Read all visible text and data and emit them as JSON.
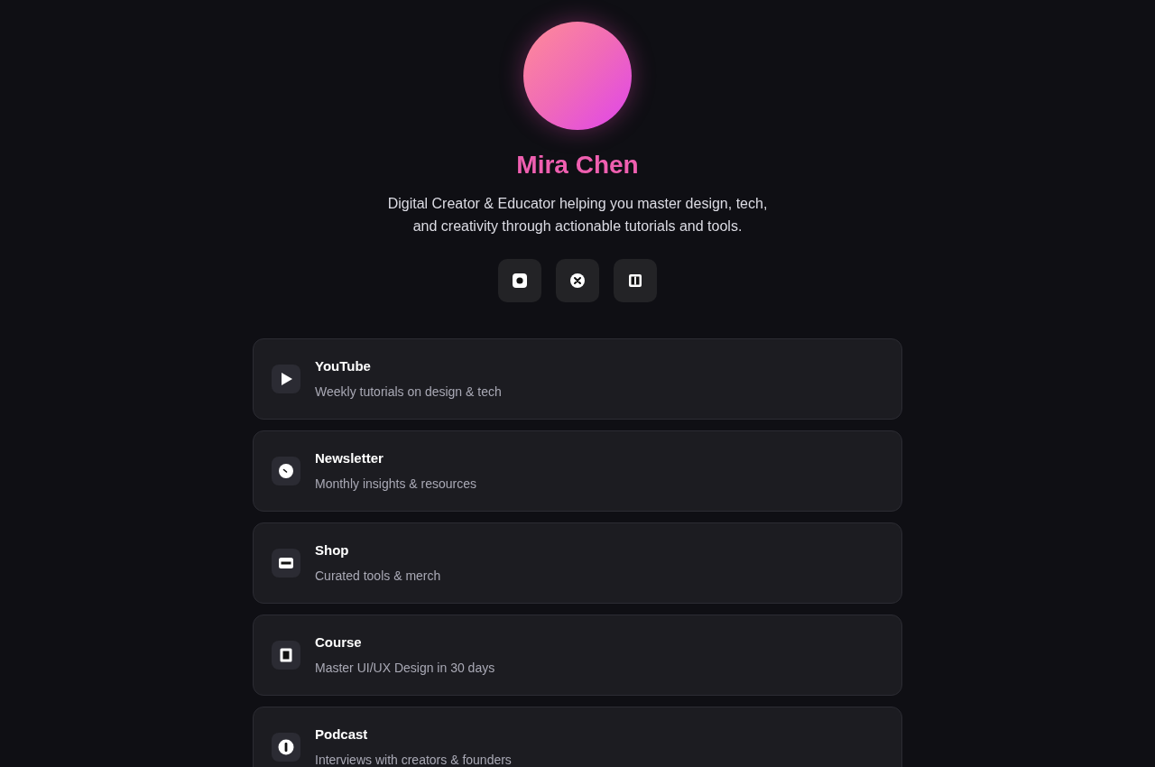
{
  "profile": {
    "name": "Mira Chen",
    "bio": "Digital Creator & Educator helping you master design, tech, and creativity through actionable tutorials and tools."
  },
  "social_buttons": [
    {
      "kind": "dot"
    },
    {
      "kind": "cross"
    },
    {
      "kind": "bars"
    }
  ],
  "links": [
    {
      "kind": "play",
      "title": "YouTube",
      "subtitle": "Weekly tutorials on design & tech"
    },
    {
      "kind": "clock",
      "title": "Newsletter",
      "subtitle": "Monthly insights & resources"
    },
    {
      "kind": "minus",
      "title": "Shop",
      "subtitle": "Curated tools & merch"
    },
    {
      "kind": "square",
      "title": "Course",
      "subtitle": "Master UI/UX Design in 30 days"
    },
    {
      "kind": "info",
      "title": "Podcast",
      "subtitle": "Interviews with creators & founders"
    }
  ]
}
